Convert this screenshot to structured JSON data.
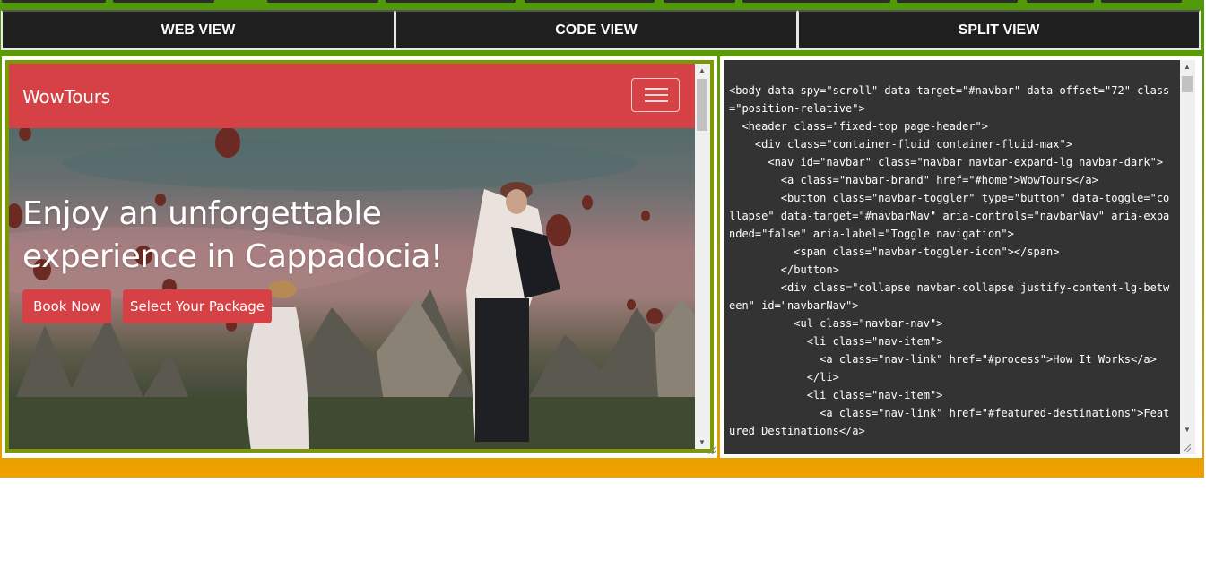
{
  "tabs": {
    "web_view": "WEB VIEW",
    "code_view": "CODE VIEW",
    "split_view": "SPLIT VIEW"
  },
  "site": {
    "brand": "WowTours",
    "hero_title": "Enjoy an unforgettable experience in Cappadocia!",
    "book_now": "Book Now",
    "select_package": "Select Your Package",
    "theme_color": "#d64145"
  },
  "code": {
    "content": "<body data-spy=\"scroll\" data-target=\"#navbar\" data-offset=\"72\" class=\"position-relative\">\n  <header class=\"fixed-top page-header\">\n    <div class=\"container-fluid container-fluid-max\">\n      <nav id=\"navbar\" class=\"navbar navbar-expand-lg navbar-dark\">\n        <a class=\"navbar-brand\" href=\"#home\">WowTours</a>\n        <button class=\"navbar-toggler\" type=\"button\" data-toggle=\"collapse\" data-target=\"#navbarNav\" aria-controls=\"navbarNav\" aria-expanded=\"false\" aria-label=\"Toggle navigation\">\n          <span class=\"navbar-toggler-icon\"></span>\n        </button>\n        <div class=\"collapse navbar-collapse justify-content-lg-between\" id=\"navbarNav\">\n          <ul class=\"navbar-nav\">\n            <li class=\"nav-item\">\n              <a class=\"nav-link\" href=\"#process\">How It Works</a>\n            </li>\n            <li class=\"nav-item\">\n              <a class=\"nav-link\" href=\"#featured-destinations\">Featured Destinations</a>"
  }
}
